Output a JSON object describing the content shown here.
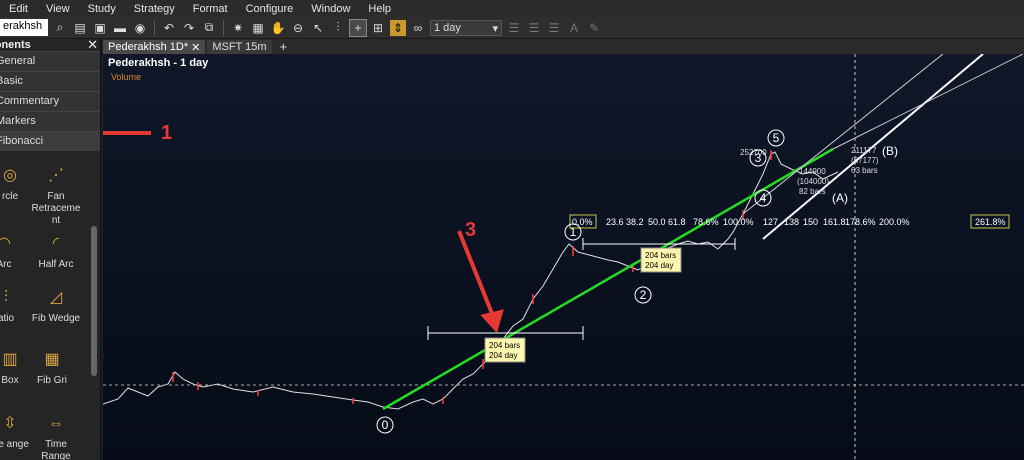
{
  "menu": [
    "Edit",
    "View",
    "Study",
    "Strategy",
    "Format",
    "Configure",
    "Window",
    "Help"
  ],
  "toolbar": {
    "symbol": "erakhsh",
    "period": "1 day"
  },
  "panel": {
    "title": "ponents",
    "close": "✕",
    "categories": [
      "General",
      "Basic",
      "Commentary",
      "Markers",
      "Fibonacci"
    ],
    "tools": {
      "circle": "rcle",
      "fan": "Fan Retraceme nt",
      "arc": "Arc",
      "half_arc": "Half Arc",
      "ratio": "atio",
      "wedge": "Fib Wedge",
      "box": "Box",
      "grid": "Fib Gri",
      "price_range": "ice ange",
      "time_range": "Time Range"
    }
  },
  "tabs": [
    "Pederakhsh 1D*",
    "MSFT 15m"
  ],
  "tab_add": "+",
  "chart": {
    "title": "Pederakhsh - 1 day",
    "subtitle": "Volume",
    "fib_levels": [
      "0.0%",
      "23.6",
      "38.2",
      "50.0",
      "61.8",
      "78.6%",
      "100.0%",
      "127",
      "138",
      "150",
      "161.8",
      "178.6%",
      "200.0%",
      "261.8%"
    ],
    "wave_labels": [
      "0",
      "1",
      "2",
      "3",
      "4",
      "5",
      "(A)",
      "(B)"
    ],
    "range_box_1": [
      "204 bars",
      "204 day"
    ],
    "range_box_2": [
      "204 bars",
      "204 day"
    ],
    "small_labels": {
      "top": "252700",
      "b1": "211177",
      "b2": "(67177)",
      "b3": "63 bars",
      "a1": "144900",
      "a2": "(104000)",
      "a3": "82 bars"
    }
  },
  "annotations": [
    "1",
    "2",
    "3"
  ],
  "colors": {
    "accent_red": "#e53935",
    "trend_green": "#22dd22",
    "fib_orange": "#d9a441"
  }
}
